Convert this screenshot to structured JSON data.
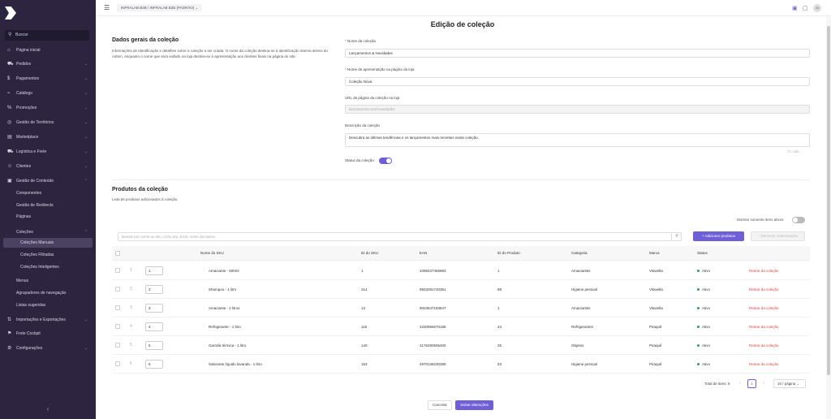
{
  "app": {
    "store": "INFRALAB B2B / INFRALAB B2B (PADRÃO)",
    "avatar": "AI"
  },
  "sidebar": {
    "search": "Buscar",
    "items": [
      {
        "label": "Página inicial",
        "icon": "home-icon",
        "glyph": "⌂",
        "chevron": ""
      },
      {
        "label": "Pedidos",
        "icon": "cart-icon",
        "glyph": "⛟",
        "chevron": "⌄"
      },
      {
        "label": "Pagamentos",
        "icon": "dollar-icon",
        "glyph": "$",
        "chevron": "⌄"
      },
      {
        "label": "Catálogo",
        "icon": "tag-icon",
        "glyph": "⌁",
        "chevron": "⌄"
      },
      {
        "label": "Promoções",
        "icon": "percent-icon",
        "glyph": "%",
        "chevron": "⌄"
      },
      {
        "label": "Gestão de Territórios",
        "icon": "globe-icon",
        "glyph": "◎",
        "chevron": "⌄"
      },
      {
        "label": "Marketplace",
        "icon": "store-icon",
        "glyph": "▤",
        "chevron": "⌄"
      },
      {
        "label": "Logística e Frete",
        "icon": "truck-icon",
        "glyph": "⛟",
        "chevron": "⌄"
      },
      {
        "label": "Clientes",
        "icon": "users-icon",
        "glyph": "☺",
        "chevron": "⌄"
      },
      {
        "label": "Gestão de Conteúdo",
        "icon": "content-icon",
        "glyph": "▣",
        "chevron": "⌃"
      }
    ],
    "content_sub": [
      "Componentes",
      "Gestão de Redirects",
      "Páginas"
    ],
    "colecoes": "Coleções",
    "colecoes_sub": [
      "Coleções Manuais",
      "Coleções Filtradas",
      "Coleções Inteligentes"
    ],
    "content_sub2": [
      "Menus",
      "Agrupadores de navegação",
      "Listas sugeridas"
    ],
    "bottom": [
      {
        "label": "Importações e Exportações",
        "icon": "import-export-icon",
        "glyph": "⇅",
        "chevron": "⌄"
      },
      {
        "label": "Frete Cockpit",
        "icon": "flag-icon",
        "glyph": "⚑",
        "chevron": ""
      },
      {
        "label": "Configurações",
        "icon": "gear-icon",
        "glyph": "⚙",
        "chevron": "⌄"
      }
    ],
    "collapse": "‹"
  },
  "page": {
    "title": "Edição de coleção"
  },
  "general": {
    "title": "Dados gerais da coleção",
    "desc": "Informações de identificação e detalhes sobre a coleção a ser criada. O nome da coleção destina-se à identificação interna dentro do Admin, enquanto o nome que será exibido na loja destina-se à apresentação aos clientes finais na página do site.",
    "name_label": "Nome da coleção",
    "name_value": "Lançamentos & Novidades",
    "display_label": "Nome de apresentação na página da loja",
    "display_value": "Coleção Nova",
    "url_label": "URL da página da coleção na loja",
    "url_value": "lancamentos-and-novidades",
    "desc_label": "Descrição da coleção",
    "desc_value": "Descubra as últimas tendências e os lançamentos mais recentes nesta coleção.",
    "desc_count": "77 / 100",
    "status_label": "Status da coleção",
    "status_on": true
  },
  "products": {
    "title": "Produtos da coleção",
    "desc": "Lista de produtos adicionados à coleção.",
    "only_active": "Mostrar somente itens ativos",
    "search_placeholder": "Buscar por nome ou sku, id do sku, EAN, nome da marca",
    "add": "Adicionar produtos",
    "remove": "Remover selecionados",
    "columns": [
      "Nome do SKU",
      "ID do SKU",
      "EAN",
      "ID do Produto",
      "Categoria",
      "Marca",
      "Status"
    ],
    "rows": [
      {
        "idx": "1",
        "pos": "1",
        "name": "Amaciante - 500ml",
        "sku": "1",
        "ean": "1098237465983",
        "pid": "1",
        "cat": "Amaciantes",
        "brand": "Vitavella",
        "status": "Ativo",
        "action": "Retirar da coleção"
      },
      {
        "idx": "2",
        "pos": "2",
        "name": "Shampoo - 1 litro",
        "sku": "214",
        "ean": "9503281740361",
        "pid": "88",
        "cat": "Higiene pessoal",
        "brand": "Vitavella",
        "status": "Ativo",
        "action": "Retirar da coleção"
      },
      {
        "idx": "3",
        "pos": "3",
        "name": "Amaciante - 2 litros",
        "sku": "13",
        "ean": "9023647193847",
        "pid": "1",
        "cat": "Amaciantes",
        "brand": "Vitavella",
        "status": "Ativo",
        "action": "Retirar da coleção"
      },
      {
        "idx": "4",
        "pos": "4",
        "name": "Refrigerante - 1 litro",
        "sku": "115",
        "ean": "4230956670185",
        "pid": "44",
        "cat": "Refrigerantes",
        "brand": "Piraquê",
        "status": "Ativo",
        "action": "Retirar da coleção"
      },
      {
        "idx": "5",
        "pos": "5",
        "name": "Garrafa térmica - 1 litro",
        "sku": "140",
        "ean": "2176290506400",
        "pid": "25",
        "cat": "Objetos",
        "brand": "Piraquê",
        "status": "Ativo",
        "action": "Retirar da coleção"
      },
      {
        "idx": "6",
        "pos": "6",
        "name": "Sabonete líquido lavanda - 1 litro",
        "sku": "163",
        "ean": "4970138230389",
        "pid": "63",
        "cat": "Higiene pessoal",
        "brand": "Piraquê",
        "status": "Ativo",
        "action": "Retirar da coleção"
      }
    ],
    "total": "Total de itens: 6",
    "page": "1",
    "page_size": "10 / página",
    "prev": "‹",
    "next": "›"
  },
  "footer": {
    "cancel": "Cancelar",
    "save": "Salvar alterações"
  },
  "colors": {
    "sidebar": "#2d2540",
    "accent": "#6f5fd6",
    "danger": "#e2463c",
    "success": "#2ea44f"
  }
}
